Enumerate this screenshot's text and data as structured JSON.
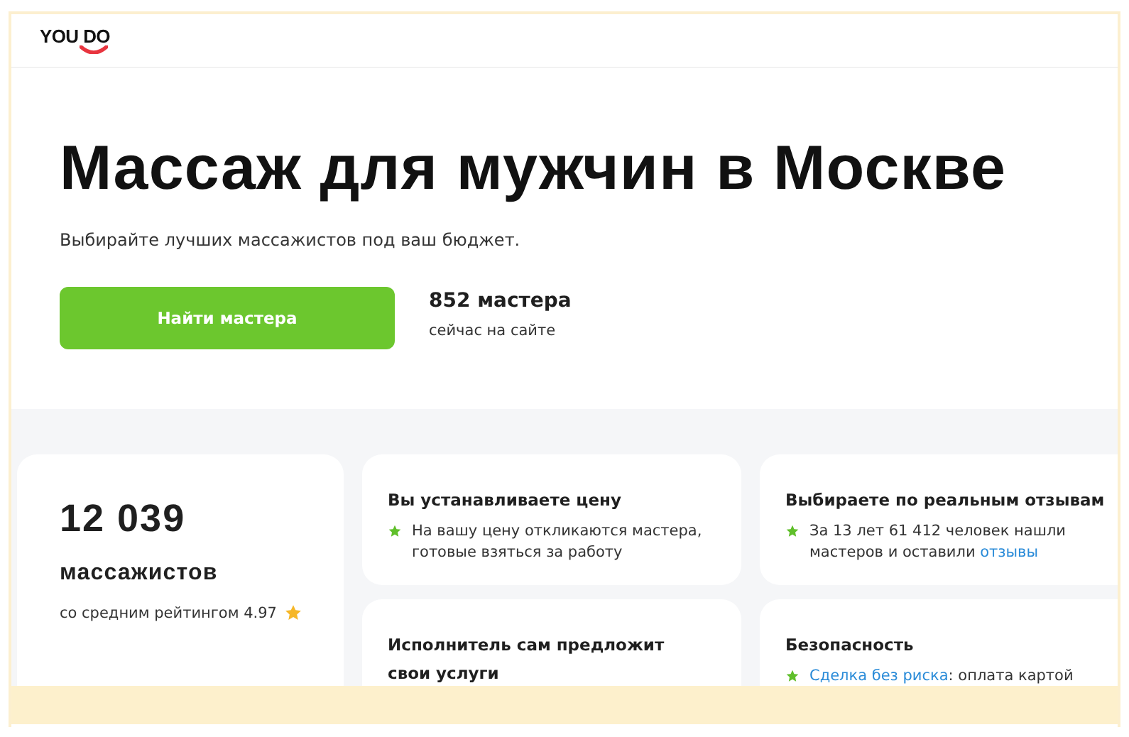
{
  "header": {
    "logo": "YOU DO"
  },
  "hero": {
    "title": "Массаж для мужчин в Москве",
    "subtitle": "Выбирайте лучших массажистов под ваш бюджет.",
    "button": "Найти мастера",
    "stat_value": "852 мастера",
    "stat_caption": "сейчас на сайте"
  },
  "summary": {
    "count": "12 039",
    "noun": "массажистов",
    "rating_text": "со средним рейтингом 4.97"
  },
  "features": [
    {
      "title": "Вы устанавливаете цену",
      "segments": [
        {
          "kind": "text",
          "text": "На вашу цену откликаются мастера, готовые взяться за работу"
        }
      ]
    },
    {
      "title": "Выбираете по реальным отзывам",
      "segments": [
        {
          "kind": "text",
          "text": "За 13 лет 61 412 человек нашли мастеров и оставили "
        },
        {
          "kind": "link",
          "text": "отзывы"
        }
      ]
    },
    {
      "title": "Исполнитель сам предложит свои услуги"
    },
    {
      "title": "Безопасность",
      "segments": [
        {
          "kind": "link",
          "text": "Сделка без риска"
        },
        {
          "kind": "text",
          "text": ": оплата картой"
        }
      ]
    }
  ]
}
